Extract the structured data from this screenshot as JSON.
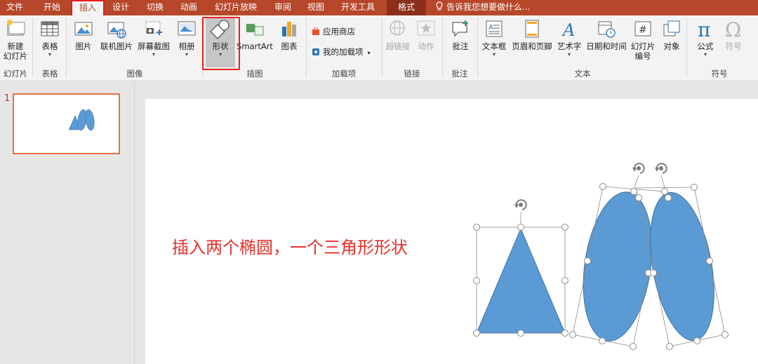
{
  "ribbon_tabs": {
    "file": "文件",
    "home": "开始",
    "insert": "插入",
    "design": "设计",
    "transitions": "切换",
    "animations": "动画",
    "slideshow": "幻灯片放映",
    "review": "审阅",
    "view": "视图",
    "developer": "开发工具",
    "format": "格式",
    "tell_me": "告诉我您想要做什么..."
  },
  "ribbon": {
    "new_slide": {
      "line1": "新建",
      "line2": "幻灯片"
    },
    "table": "表格",
    "picture": "图片",
    "online_picture": "联机图片",
    "screenshot": "屏幕截图",
    "album": "相册",
    "shapes": "形状",
    "smartart": "SmartArt",
    "chart": "图表",
    "app_store": "应用商店",
    "my_addins": "我的加载项",
    "hyperlink": "超链接",
    "action": "动作",
    "comment": "批注",
    "textbox": "文本框",
    "header_footer": "页眉和页脚",
    "wordart": "艺术字",
    "datetime": "日期和时间",
    "slide_number": {
      "line1": "幻灯片",
      "line2": "编号"
    },
    "object": "对象",
    "equation": "公式",
    "symbol": "符号",
    "groups": {
      "slides": "幻灯片",
      "tables": "表格",
      "images": "图像",
      "illustrations": "插图",
      "addins": "加载项",
      "links": "链接",
      "comments": "批注",
      "text": "文本",
      "symbols": "符号"
    }
  },
  "thumbnails": [
    {
      "number": "1"
    }
  ],
  "slide": {
    "caption": "插入两个椭圆，一个三角形形状",
    "shape_fill": "#5b9bd5",
    "shape_stroke": "#41719c"
  },
  "colors": {
    "accent": "#b7472a",
    "highlight": "#ee1c1c",
    "caption": "#e8302a"
  }
}
